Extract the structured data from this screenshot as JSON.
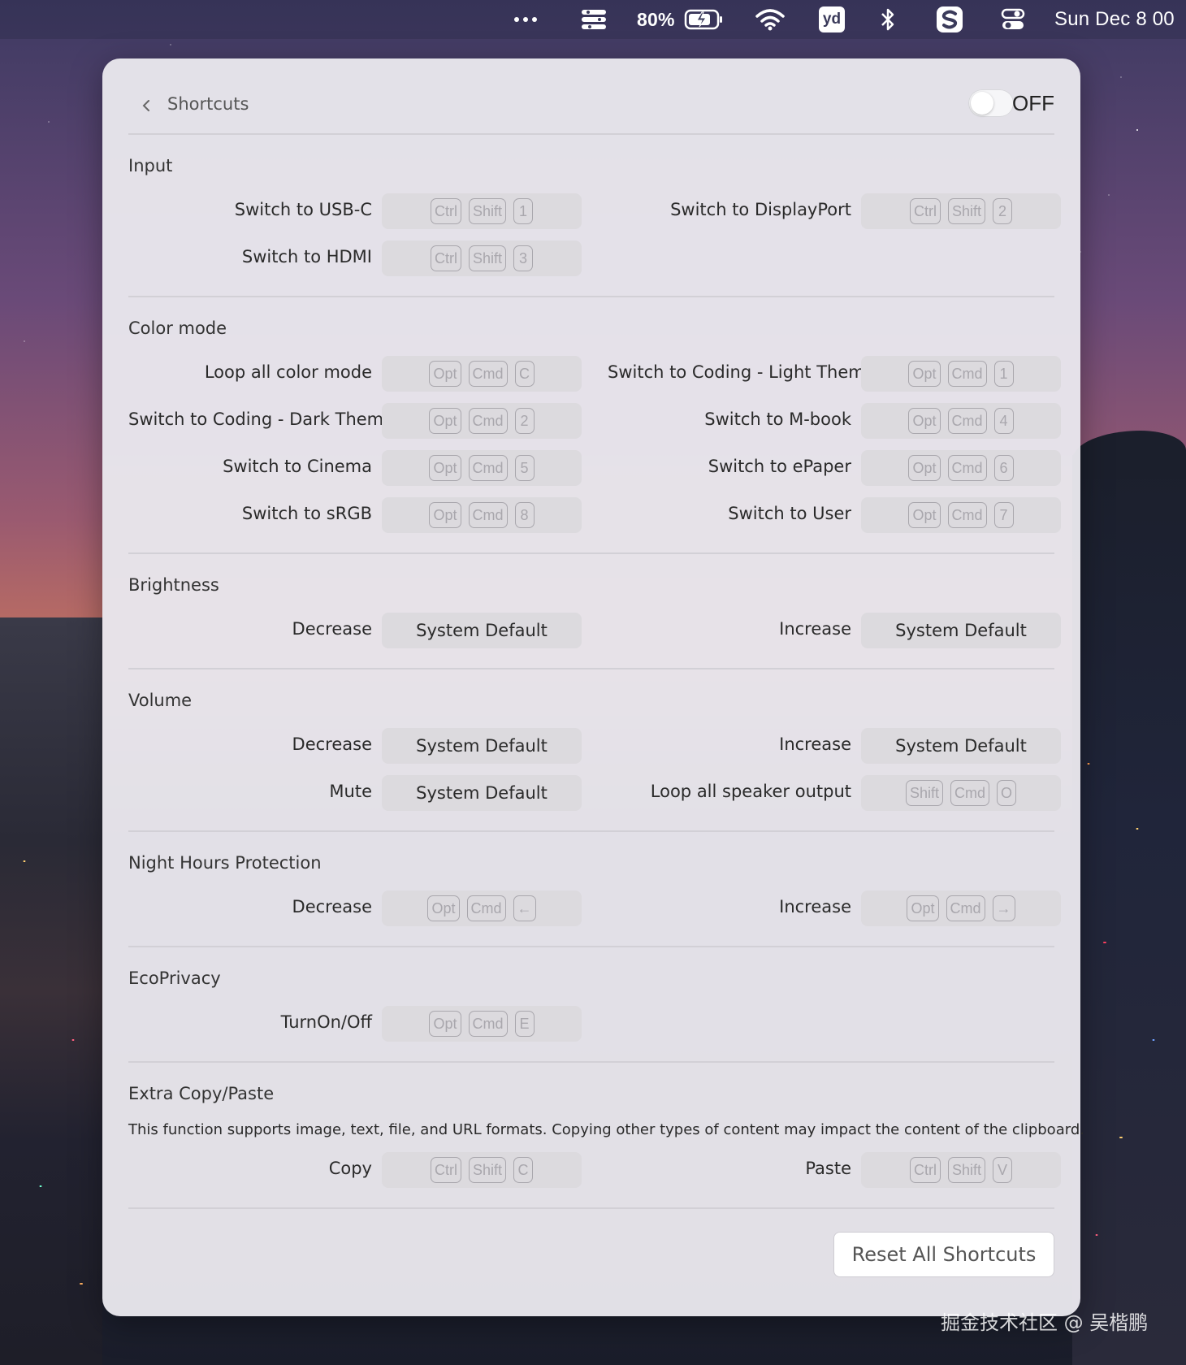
{
  "menubar": {
    "battery": "80%",
    "clock": "Sun Dec 8  00",
    "icons": [
      "more-icon",
      "display-icon",
      "battery-icon",
      "wifi-icon",
      "youdao-icon",
      "bluetooth-icon",
      "s-app-icon",
      "control-center-icon"
    ],
    "yd_label": "yd"
  },
  "header": {
    "title": "Shortcuts",
    "toggle_label": "OFF"
  },
  "sections": {
    "input": {
      "title": "Input",
      "rows": [
        {
          "label": "Switch to USB-C",
          "keys": [
            "Ctrl",
            "Shift",
            "1"
          ]
        },
        {
          "label": "Switch to DisplayPort",
          "keys": [
            "Ctrl",
            "Shift",
            "2"
          ]
        },
        {
          "label": "Switch to HDMI",
          "keys": [
            "Ctrl",
            "Shift",
            "3"
          ]
        }
      ]
    },
    "color_mode": {
      "title": "Color mode",
      "rows": [
        {
          "label": "Loop all color mode",
          "keys": [
            "Opt",
            "Cmd",
            "C"
          ]
        },
        {
          "label": "Switch to Coding - Light Theme",
          "keys": [
            "Opt",
            "Cmd",
            "1"
          ]
        },
        {
          "label": "Switch to Coding - Dark Theme",
          "keys": [
            "Opt",
            "Cmd",
            "2"
          ]
        },
        {
          "label": "Switch to M-book",
          "keys": [
            "Opt",
            "Cmd",
            "4"
          ]
        },
        {
          "label": "Switch to Cinema",
          "keys": [
            "Opt",
            "Cmd",
            "5"
          ]
        },
        {
          "label": "Switch to ePaper",
          "keys": [
            "Opt",
            "Cmd",
            "6"
          ]
        },
        {
          "label": "Switch to sRGB",
          "keys": [
            "Opt",
            "Cmd",
            "8"
          ]
        },
        {
          "label": "Switch to User",
          "keys": [
            "Opt",
            "Cmd",
            "7"
          ]
        }
      ]
    },
    "brightness": {
      "title": "Brightness",
      "rows": [
        {
          "label": "Decrease",
          "value": "System Default"
        },
        {
          "label": "Increase",
          "value": "System Default"
        }
      ]
    },
    "volume": {
      "title": "Volume",
      "rows": [
        {
          "label": "Decrease",
          "value": "System Default"
        },
        {
          "label": "Increase",
          "value": "System Default"
        },
        {
          "label": "Mute",
          "value": "System Default"
        },
        {
          "label": "Loop all speaker output",
          "keys": [
            "Shift",
            "Cmd",
            "O"
          ]
        }
      ]
    },
    "night": {
      "title": "Night Hours Protection",
      "rows": [
        {
          "label": "Decrease",
          "keys": [
            "Opt",
            "Cmd",
            "←"
          ]
        },
        {
          "label": "Increase",
          "keys": [
            "Opt",
            "Cmd",
            "→"
          ]
        }
      ]
    },
    "ecoprivacy": {
      "title": "EcoPrivacy",
      "rows": [
        {
          "label": "TurnOn/Off",
          "keys": [
            "Opt",
            "Cmd",
            "E"
          ]
        }
      ]
    },
    "copypaste": {
      "title": "Extra Copy/Paste",
      "description": "This function supports image, text, file, and URL formats. Copying other types of content may impact the content of the clipboard.",
      "rows": [
        {
          "label": "Copy",
          "keys": [
            "Ctrl",
            "Shift",
            "C"
          ]
        },
        {
          "label": "Paste",
          "keys": [
            "Ctrl",
            "Shift",
            "V"
          ]
        }
      ]
    }
  },
  "reset_label": "Reset All Shortcuts",
  "watermark": "掘金技术社区 @ 吴楷鹏"
}
